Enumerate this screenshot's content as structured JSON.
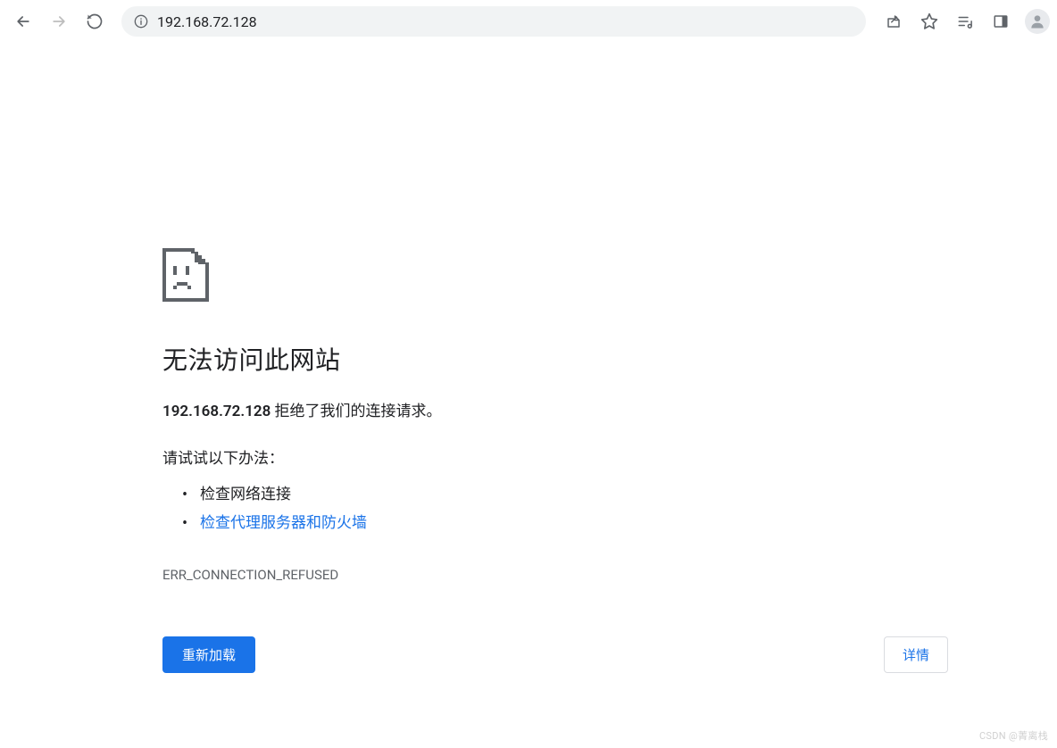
{
  "toolbar": {
    "url": "192.168.72.128"
  },
  "error": {
    "title": "无法访问此网站",
    "host": "192.168.72.128",
    "message_suffix": " 拒绝了我们的连接请求。",
    "suggestions_title": "请试试以下办法：",
    "suggestions": [
      "检查网络连接",
      "检查代理服务器和防火墙"
    ],
    "error_code": "ERR_CONNECTION_REFUSED",
    "reload_label": "重新加载",
    "details_label": "详情"
  },
  "watermark": "CSDN @菁离栈"
}
